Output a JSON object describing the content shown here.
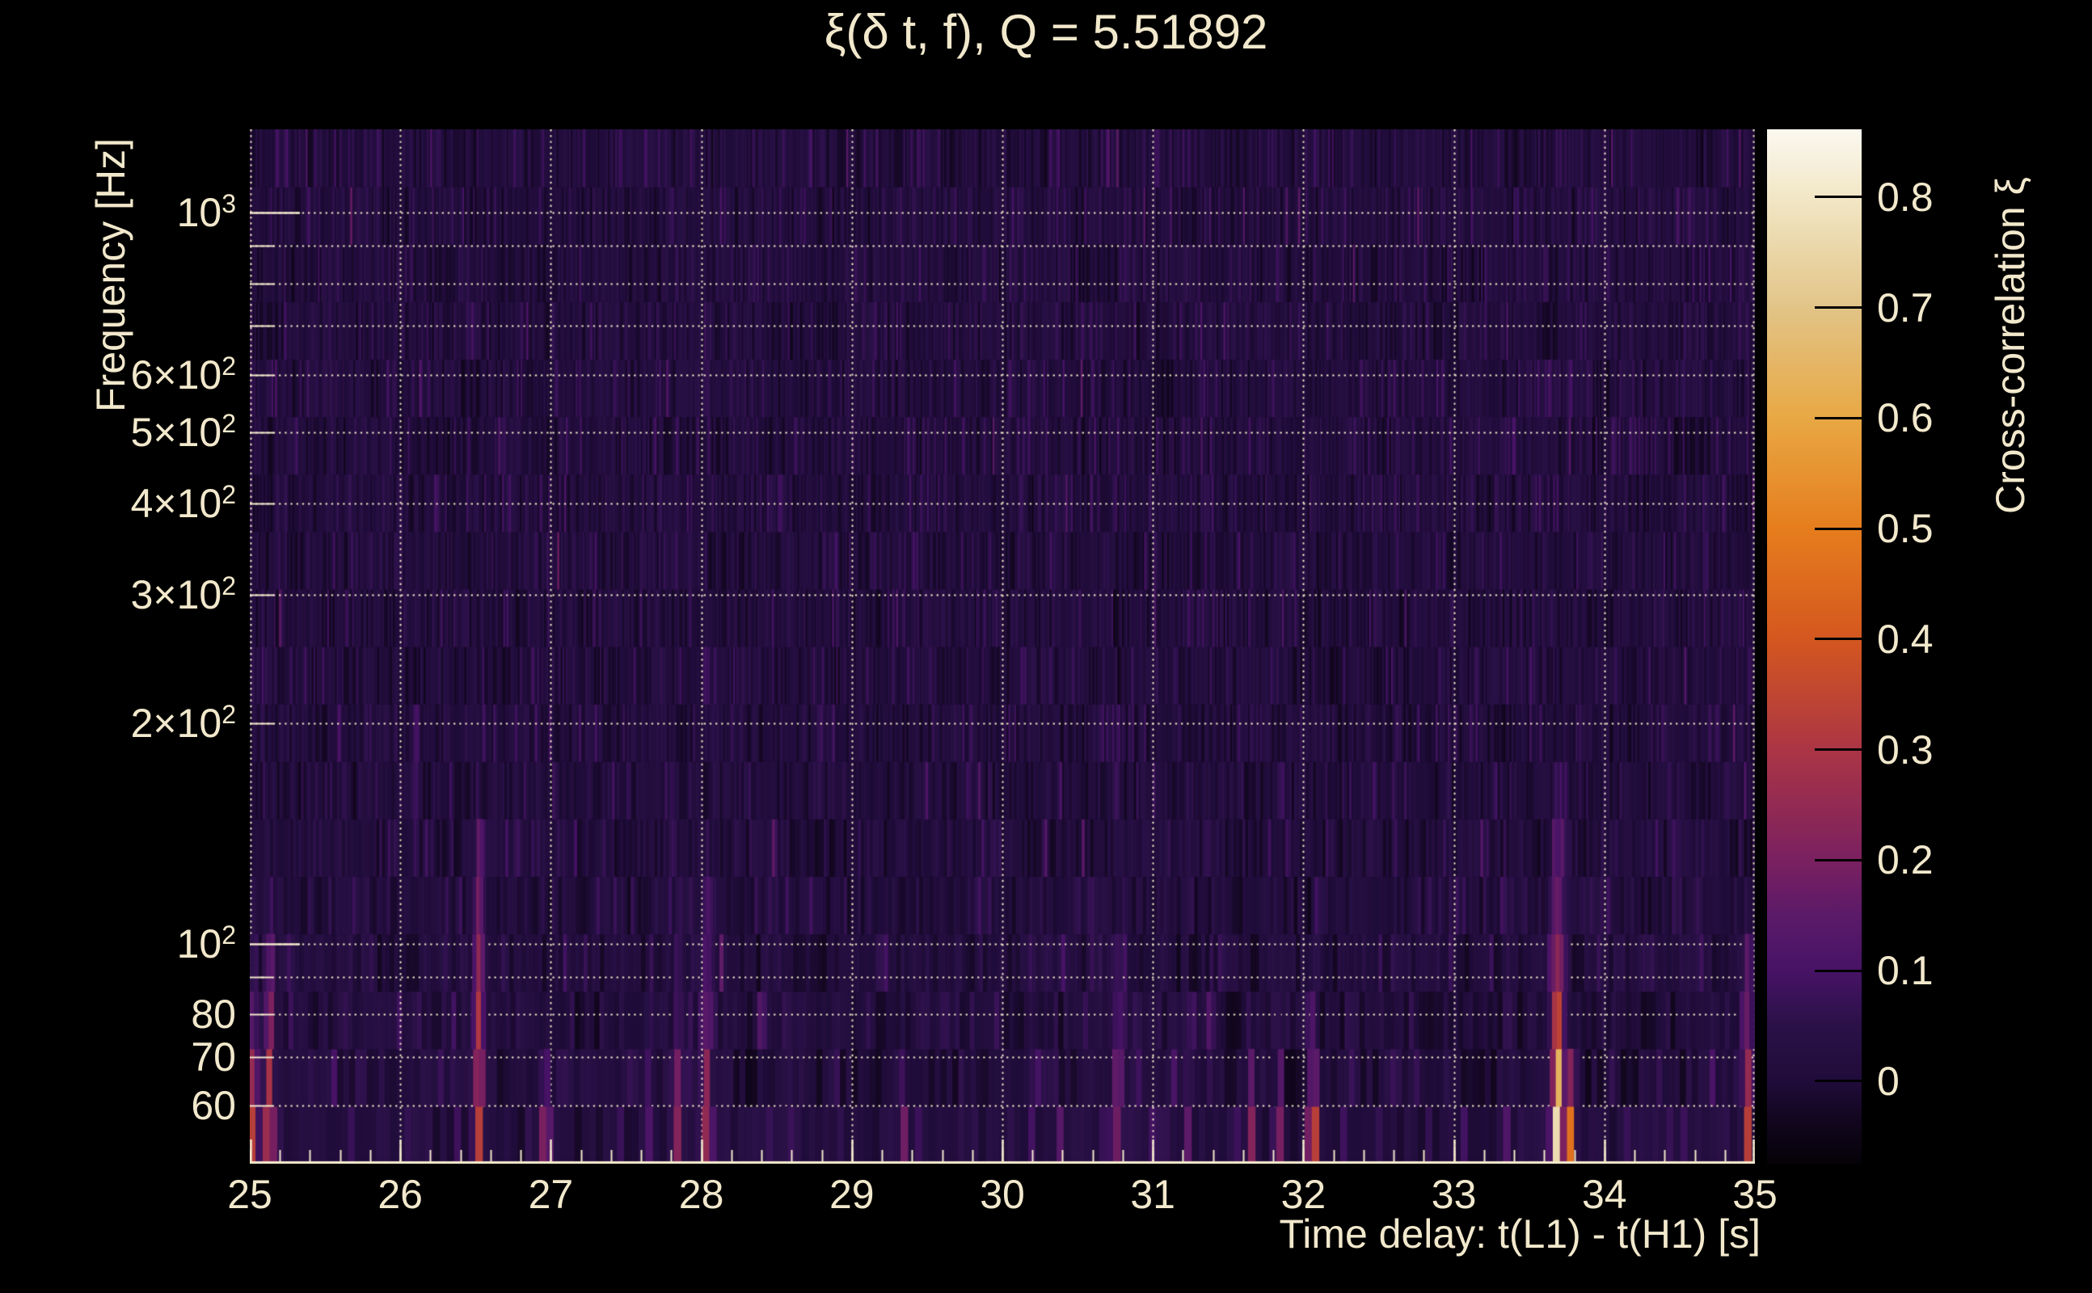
{
  "page": {
    "background": "#000000",
    "text_color": "#f2e8cc"
  },
  "chart_data": {
    "type": "heatmap",
    "title": "ξ(δ t, f), Q = 5.51892",
    "xlabel": "Time delay: t(L1) - t(H1) [s]",
    "ylabel": "Frequency [Hz]",
    "legend_position": "right-colorbar",
    "grid": "dotted",
    "x_axis": {
      "range": [
        25,
        35
      ],
      "major_ticks": [
        "25",
        "26",
        "27",
        "28",
        "29",
        "30",
        "31",
        "32",
        "33",
        "34",
        "35"
      ],
      "minor_step": 0.2
    },
    "y_axis": {
      "scale": "log",
      "range_hz": [
        50,
        1300
      ],
      "grid_hz": [
        60,
        70,
        80,
        90,
        100,
        200,
        300,
        400,
        500,
        600,
        700,
        800,
        900,
        1000
      ],
      "tick_labels": [
        {
          "f": 1000,
          "main": "10",
          "sup": "3"
        },
        {
          "f": 600,
          "main": "6×10",
          "sup": "2"
        },
        {
          "f": 500,
          "main": "5×10",
          "sup": "2"
        },
        {
          "f": 400,
          "main": "4×10",
          "sup": "2"
        },
        {
          "f": 300,
          "main": "3×10",
          "sup": "2"
        },
        {
          "f": 200,
          "main": "2×10",
          "sup": "2"
        },
        {
          "f": 100,
          "main": "10",
          "sup": "2"
        },
        {
          "f": 80,
          "main": "80",
          "sup": ""
        },
        {
          "f": 70,
          "main": "70",
          "sup": ""
        },
        {
          "f": 60,
          "main": "60",
          "sup": ""
        }
      ]
    },
    "colorbar": {
      "label": "Cross-correlation ξ",
      "value_range": [
        -0.0746,
        0.8614
      ],
      "ticks": [
        {
          "v": 0.8,
          "label": "0.8"
        },
        {
          "v": 0.7,
          "label": "0.7"
        },
        {
          "v": 0.6,
          "label": "0.6"
        },
        {
          "v": 0.5,
          "label": "0.5"
        },
        {
          "v": 0.4,
          "label": "0.4"
        },
        {
          "v": 0.3,
          "label": "0.3"
        },
        {
          "v": 0.2,
          "label": "0.2"
        },
        {
          "v": 0.1,
          "label": "0.1"
        },
        {
          "v": 0.0,
          "label": "0"
        }
      ],
      "colormap": [
        [
          -0.0746,
          "#050208"
        ],
        [
          -0.03,
          "#140722"
        ],
        [
          0.0,
          "#200c3a"
        ],
        [
          0.05,
          "#2a1147"
        ],
        [
          0.1,
          "#471366"
        ],
        [
          0.15,
          "#5b1a68"
        ],
        [
          0.2,
          "#7a2060"
        ],
        [
          0.3,
          "#ab3545"
        ],
        [
          0.4,
          "#d4571f"
        ],
        [
          0.5,
          "#e67d1d"
        ],
        [
          0.6,
          "#e8a844"
        ],
        [
          0.7,
          "#e2c487"
        ],
        [
          0.8,
          "#f2e7c6"
        ],
        [
          0.8614,
          "#fbf8f0"
        ]
      ]
    },
    "style": {
      "grid_color": "#efe5c8",
      "axis_color": "#f2e8cc",
      "colorbar_tick_color": "#000000"
    },
    "background_noise": {
      "seed": 1337,
      "rows": 18,
      "value_range": [
        -0.06,
        0.12
      ]
    },
    "hotspots": [
      {
        "t": 25.02,
        "f_solid": 58,
        "f_max": 108,
        "amp": 0.3,
        "sigma": 0.022
      },
      {
        "t": 25.13,
        "f_solid": 62,
        "f_max": 112,
        "amp": 0.34,
        "sigma": 0.022
      },
      {
        "t": 26.52,
        "f_solid": 70,
        "f_max": 168,
        "amp": 0.3,
        "sigma": 0.022
      },
      {
        "t": 26.97,
        "f_solid": 52,
        "f_max": 68,
        "amp": 0.34,
        "sigma": 0.02
      },
      {
        "t": 27.64,
        "f_solid": 55,
        "f_max": 95,
        "amp": 0.14,
        "sigma": 0.02
      },
      {
        "t": 27.84,
        "f_solid": 60,
        "f_max": 120,
        "amp": 0.18,
        "sigma": 0.02
      },
      {
        "t": 28.04,
        "f_solid": 62,
        "f_max": 138,
        "amp": 0.24,
        "sigma": 0.022
      },
      {
        "t": 28.55,
        "f_solid": 50,
        "f_max": 58,
        "amp": 0.12,
        "sigma": 0.02
      },
      {
        "t": 29.34,
        "f_solid": 52,
        "f_max": 66,
        "amp": 0.18,
        "sigma": 0.02
      },
      {
        "t": 30.77,
        "f_solid": 55,
        "f_max": 115,
        "amp": 0.18,
        "sigma": 0.02
      },
      {
        "t": 31.23,
        "f_solid": 52,
        "f_max": 76,
        "amp": 0.16,
        "sigma": 0.02
      },
      {
        "t": 31.65,
        "f_solid": 55,
        "f_max": 82,
        "amp": 0.22,
        "sigma": 0.02
      },
      {
        "t": 31.83,
        "f_solid": 52,
        "f_max": 95,
        "amp": 0.15,
        "sigma": 0.02
      },
      {
        "t": 32.06,
        "f_solid": 54,
        "f_max": 64,
        "amp": 0.64,
        "sigma": 0.018
      },
      {
        "t": 32.06,
        "f_solid": 50,
        "f_max": 78,
        "amp": 0.4,
        "sigma": 0.022
      },
      {
        "t": 32.06,
        "f_solid": 50,
        "f_max": 108,
        "amp": 0.18,
        "sigma": 0.026
      },
      {
        "t": 33.33,
        "f_solid": 50,
        "f_max": 58,
        "amp": 0.22,
        "sigma": 0.018
      },
      {
        "t": 33.69,
        "f_solid": 58,
        "f_max": 90,
        "amp": 0.88,
        "sigma": 0.016
      },
      {
        "t": 33.69,
        "f_solid": 52,
        "f_max": 126,
        "amp": 0.6,
        "sigma": 0.026
      },
      {
        "t": 33.69,
        "f_solid": 50,
        "f_max": 176,
        "amp": 0.3,
        "sigma": 0.034
      },
      {
        "t": 33.785,
        "f_solid": 53,
        "f_max": 82,
        "amp": 0.46,
        "sigma": 0.018
      },
      {
        "t": 34.95,
        "f_solid": 56,
        "f_max": 110,
        "amp": 0.3,
        "sigma": 0.022
      }
    ]
  }
}
